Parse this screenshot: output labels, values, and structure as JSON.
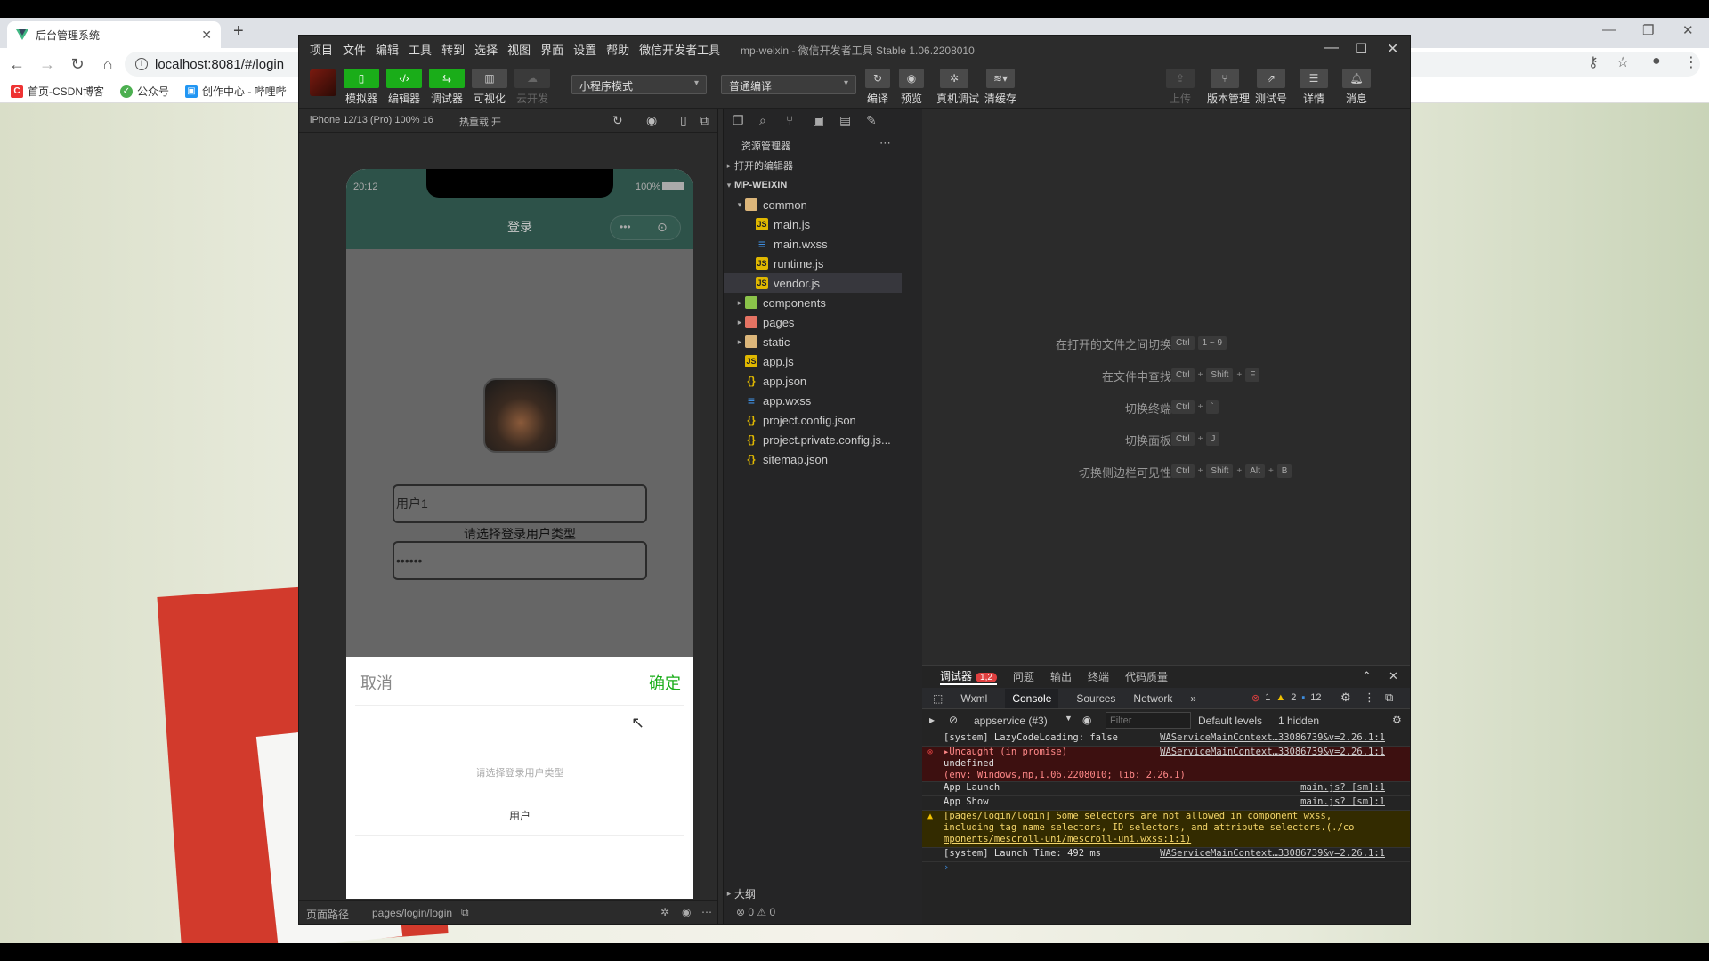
{
  "browser": {
    "tab_title": "后台管理系统",
    "url": "localhost:8081/#/login",
    "bookmarks": [
      "首页-CSDN博客",
      "公众号",
      "创作中心 - 哔哩哔"
    ]
  },
  "devtools": {
    "menu": [
      "项目",
      "文件",
      "编辑",
      "工具",
      "转到",
      "选择",
      "视图",
      "界面",
      "设置",
      "帮助",
      "微信开发者工具"
    ],
    "window_title": "mp-weixin - 微信开发者工具 Stable 1.06.2208010",
    "toolbar": {
      "simulator": "模拟器",
      "editor": "编辑器",
      "debugger": "调试器",
      "visual": "可视化",
      "cloud": "云开发",
      "mode": "小程序模式",
      "compile_mode": "普通编译",
      "compile": "编译",
      "preview": "预览",
      "remote_debug": "真机调试",
      "clear_cache": "清缓存",
      "upload": "上传",
      "version": "版本管理",
      "test": "测试号",
      "details": "详情",
      "messages": "消息"
    },
    "simulator": {
      "device": "iPhone 12/13 (Pro) 100% 16",
      "hot_reload": "热重载 开",
      "time": "20:12",
      "battery": "100%",
      "nav_title": "登录",
      "username": "用户1",
      "password": "••••••",
      "hint": "请选择登录用户类型",
      "picker_cancel": "取消",
      "picker_ok": "确定",
      "picker_options": [
        "请选择登录用户类型",
        "用户"
      ],
      "path_label": "页面路径",
      "path": "pages/login/login"
    },
    "explorer": {
      "title": "资源管理器",
      "open_editors": "打开的编辑器",
      "root": "MP-WEIXIN",
      "tree": [
        "common",
        "main.js",
        "main.wxss",
        "runtime.js",
        "vendor.js",
        "components",
        "pages",
        "static",
        "app.js",
        "app.json",
        "app.wxss",
        "project.config.json",
        "project.private.config.js...",
        "sitemap.json"
      ],
      "outline": "大纲",
      "status": "⊗ 0 ⚠ 0"
    },
    "shortcuts": [
      {
        "label": "在打开的文件之间切换",
        "keys": [
          "Ctrl",
          "1 ~ 9"
        ]
      },
      {
        "label": "在文件中查找",
        "keys": [
          "Ctrl",
          "+",
          "Shift",
          "+",
          "F"
        ]
      },
      {
        "label": "切换终端",
        "keys": [
          "Ctrl",
          "+",
          "`"
        ]
      },
      {
        "label": "切换面板",
        "keys": [
          "Ctrl",
          "+",
          "J"
        ]
      },
      {
        "label": "切换侧边栏可见性",
        "keys": [
          "Ctrl",
          "+",
          "Shift",
          "+",
          "Alt",
          "+",
          "B"
        ]
      }
    ],
    "debugger": {
      "tabs": [
        "调试器",
        "问题",
        "输出",
        "终端",
        "代码质量"
      ],
      "badge": "1,2",
      "dt_tabs": [
        "Wxml",
        "Console",
        "Sources",
        "Network"
      ],
      "counts": {
        "errors": "1",
        "warnings": "2",
        "info": "12"
      },
      "context": "appservice (#3)",
      "filter_placeholder": "Filter",
      "levels": "Default levels",
      "hidden": "1 hidden",
      "logs": [
        {
          "type": "log",
          "text": "[system] LazyCodeLoading: false",
          "src": "WAServiceMainContext…33086739&v=2.26.1:1"
        },
        {
          "type": "error",
          "text": "▸Uncaught (in promise)",
          "text2": "undefined",
          "text3": "(env: Windows,mp,1.06.2208010; lib: 2.26.1)",
          "src": "WAServiceMainContext…33086739&v=2.26.1:1"
        },
        {
          "type": "log",
          "text": "App Launch",
          "src": "main.js? [sm]:1"
        },
        {
          "type": "log",
          "text": "App Show",
          "src": "main.js? [sm]:1"
        },
        {
          "type": "warn",
          "text": "[pages/login/login] Some selectors are not allowed in component wxss,",
          "text2": "including tag name selectors, ID selectors, and attribute selectors.(./co",
          "text3": "mponents/mescroll-uni/mescroll-uni.wxss:1:1)"
        },
        {
          "type": "log",
          "text": "[system] Launch Time: 492 ms",
          "src": "WAServiceMainContext…33086739&v=2.26.1:1"
        }
      ]
    }
  }
}
